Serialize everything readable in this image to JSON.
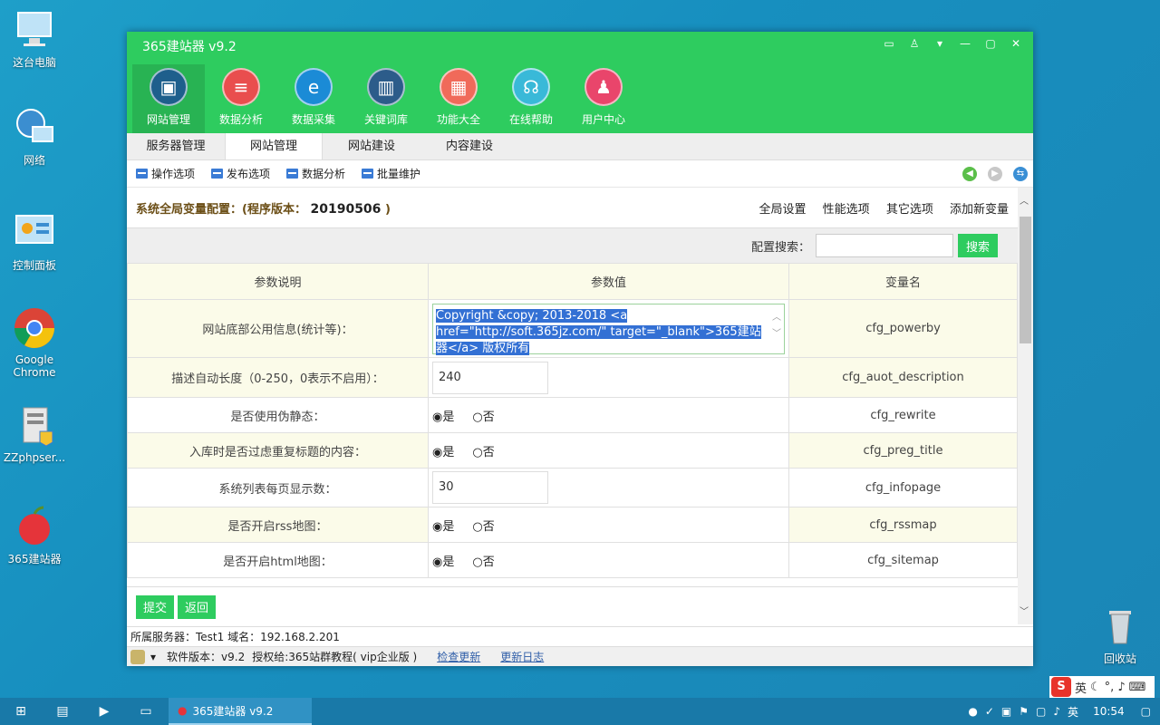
{
  "desktop": {
    "icons": [
      {
        "label": "这台电脑"
      },
      {
        "label": "网络"
      },
      {
        "label": "控制面板"
      },
      {
        "label": "Google Chrome"
      },
      {
        "label": "ZZphpser..."
      },
      {
        "label": "365建站器"
      },
      {
        "label": "回收站"
      }
    ]
  },
  "window": {
    "title": "365建站器 v9.2",
    "modules": [
      {
        "label": "网站管理",
        "color": "#1e5f8c"
      },
      {
        "label": "数据分析",
        "color": "#e94e4e"
      },
      {
        "label": "数据采集",
        "color": "#1b8bd6"
      },
      {
        "label": "关键词库",
        "color": "#2c5c8a"
      },
      {
        "label": "功能大全",
        "color": "#f06a5a"
      },
      {
        "label": "在线帮助",
        "color": "#39b9d8"
      },
      {
        "label": "用户中心",
        "color": "#e9456b"
      }
    ],
    "tabs": [
      "服务器管理",
      "网站管理",
      "网站建设",
      "内容建设"
    ],
    "toolbar": [
      "操作选项",
      "发布选项",
      "数据分析",
      "批量维护"
    ],
    "config": {
      "title_prefix": "系统全局变量配置：(程序版本：",
      "version": "20190506",
      "title_suffix": ")",
      "links": [
        "全局设置",
        "性能选项",
        "其它选项",
        "添加新变量"
      ],
      "search_label": "配置搜索：",
      "search_button": "搜索"
    },
    "table": {
      "headers": [
        "参数说明",
        "参数值",
        "变量名"
      ],
      "rows": [
        {
          "desc": "网站底部公用信息(统计等)：",
          "value": "Copyright &copy; 2013-2018 <a href=\"http://soft.365jz.com/\" target=\"_blank\">365建站器</a> 版权所有",
          "var": "cfg_powerby"
        },
        {
          "desc": "描述自动长度（0-250，0表示不启用）：",
          "value": "240",
          "var": "cfg_auot_description"
        },
        {
          "desc": "是否使用伪静态：",
          "yes": "是",
          "no": "否",
          "var": "cfg_rewrite"
        },
        {
          "desc": "入库时是否过虑重复标题的内容：",
          "yes": "是",
          "no": "否",
          "var": "cfg_preg_title"
        },
        {
          "desc": "系统列表每页显示数：",
          "value": "30",
          "var": "cfg_infopage"
        },
        {
          "desc": "是否开启rss地图：",
          "yes": "是",
          "no": "否",
          "var": "cfg_rssmap"
        },
        {
          "desc": "是否开启html地图：",
          "yes": "是",
          "no": "否",
          "var": "cfg_sitemap"
        }
      ]
    },
    "actions": {
      "submit": "提交",
      "back": "返回"
    },
    "server_info": "所属服务器：Test1 域名：192.168.2.201",
    "status": {
      "version": "软件版本：v9.2",
      "license": "授权给:365站群教程( vip企业版 )",
      "check_update": "检查更新",
      "changelog": "更新日志"
    }
  },
  "taskbar": {
    "app": "365建站器 v9.2",
    "ime_lang": "英",
    "tray_lang": "英",
    "clock": "10:54"
  }
}
